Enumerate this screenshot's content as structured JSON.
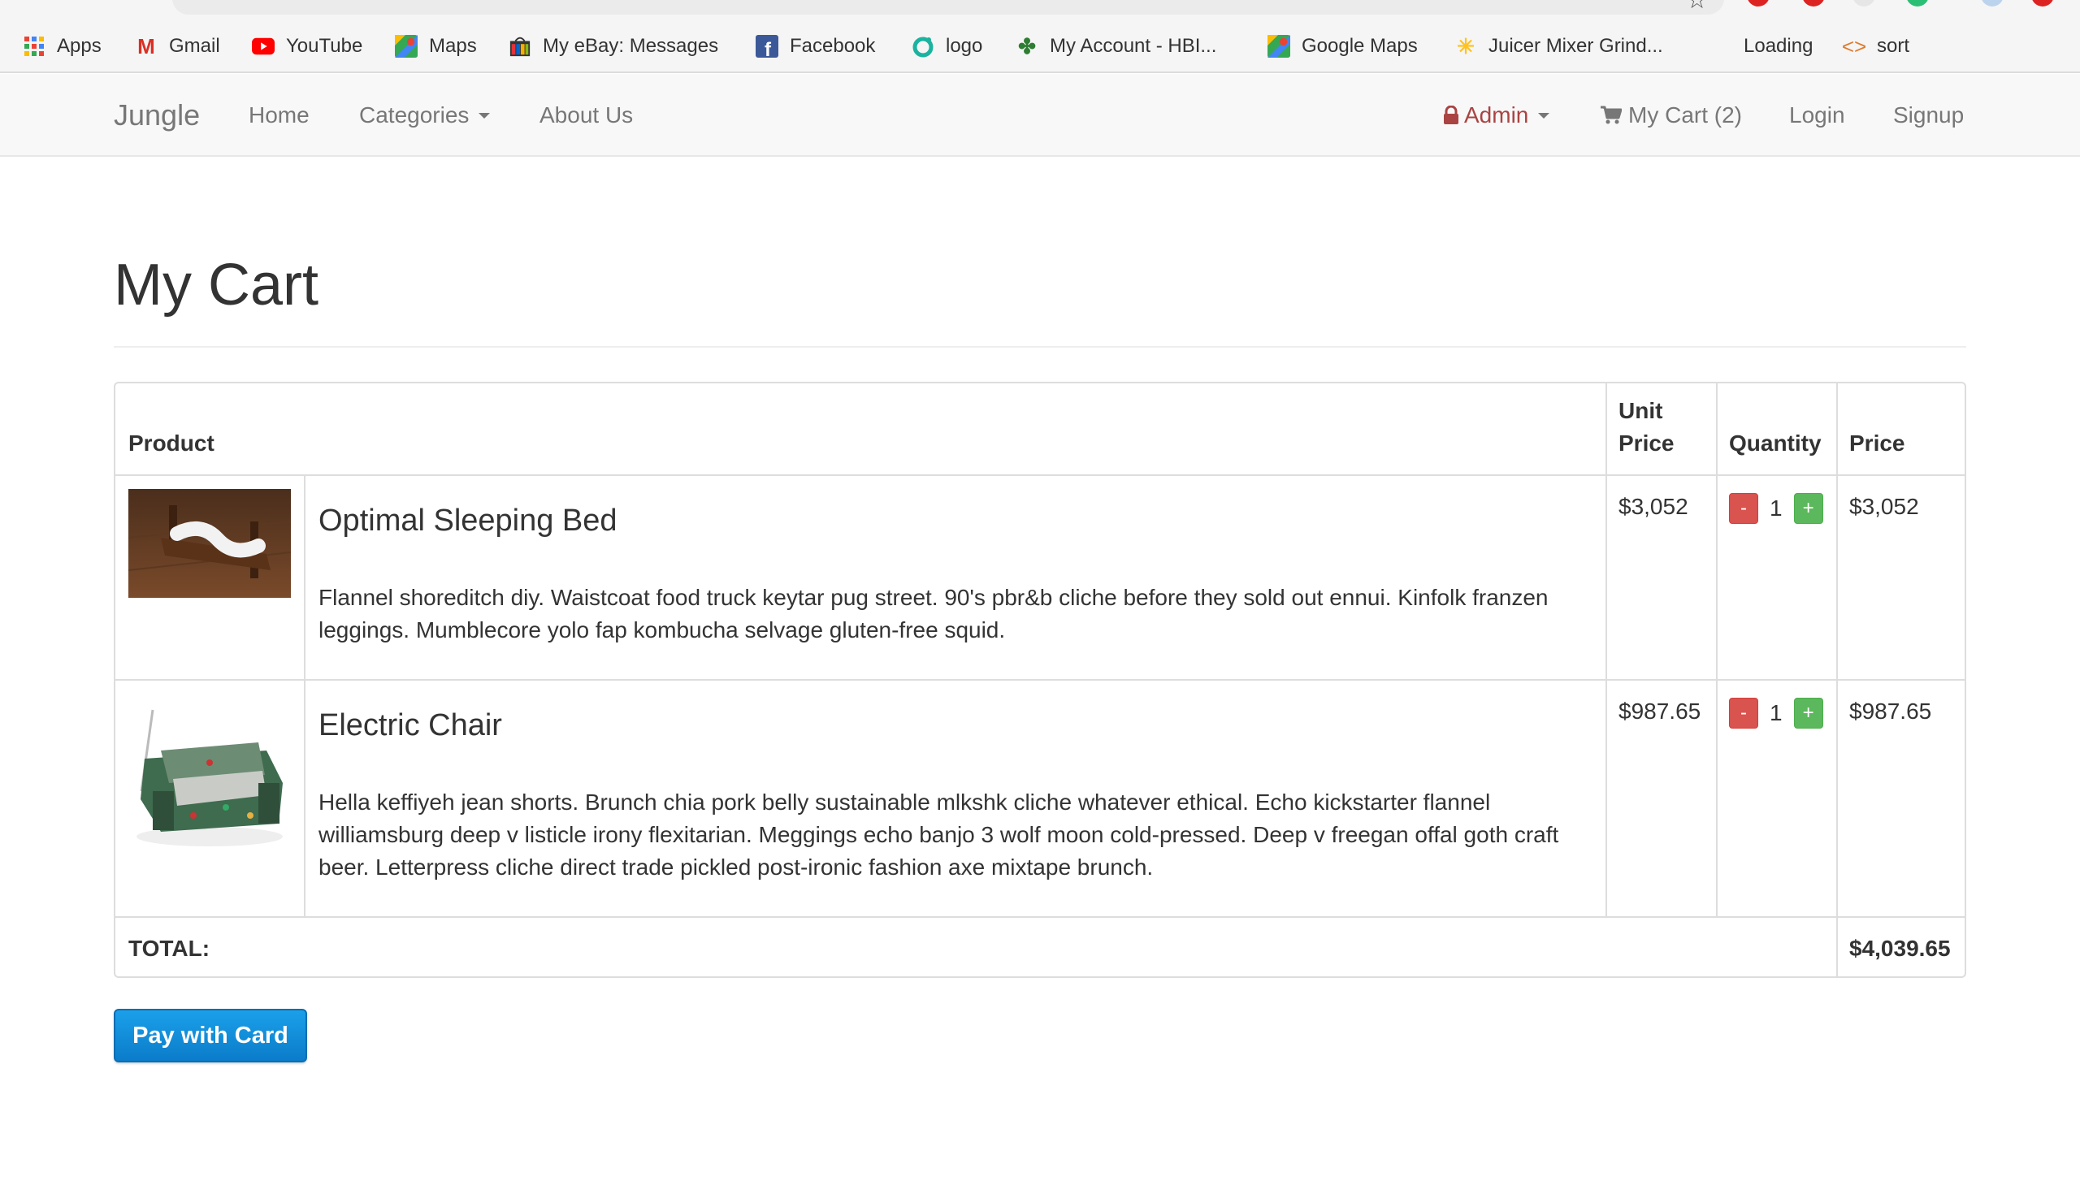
{
  "bookmarks": [
    {
      "label": "Apps",
      "icon": "apps-grid-icon"
    },
    {
      "label": "Gmail",
      "icon": "gmail-icon"
    },
    {
      "label": "YouTube",
      "icon": "youtube-icon"
    },
    {
      "label": "Maps",
      "icon": "maps-icon"
    },
    {
      "label": "My eBay: Messages",
      "icon": "ebay-icon"
    },
    {
      "label": "Facebook",
      "icon": "facebook-icon"
    },
    {
      "label": "logo",
      "icon": "logo-ring-icon"
    },
    {
      "label": "My Account - HBI...",
      "icon": "maple-leaf-icon"
    },
    {
      "label": "Google Maps",
      "icon": "maps-icon"
    },
    {
      "label": "Juicer Mixer Grind...",
      "icon": "walmart-spark-icon"
    },
    {
      "label": "Loading",
      "icon": ""
    },
    {
      "label": "sort",
      "icon": "code-brackets-icon"
    }
  ],
  "navbar": {
    "brand": "Jungle",
    "home": "Home",
    "categories": "Categories",
    "about": "About Us",
    "admin": "Admin",
    "cart": "My Cart (2)",
    "login": "Login",
    "signup": "Signup"
  },
  "page": {
    "title": "My Cart"
  },
  "table": {
    "headers": {
      "product": "Product",
      "unit_price_1": "Unit",
      "unit_price_2": "Price",
      "quantity": "Quantity",
      "price": "Price"
    },
    "rows": [
      {
        "name": "Optimal Sleeping Bed",
        "description": "Flannel shoreditch diy. Waistcoat food truck keytar pug street. 90's pbr&b cliche before they sold out ennui. Kinfolk franzen leggings. Mumblecore yolo fap kombucha selvage gluten-free squid.",
        "unit_price": "$3,052",
        "quantity": "1",
        "price": "$3,052",
        "minus": "-",
        "plus": "+"
      },
      {
        "name": "Electric Chair",
        "description": "Hella keffiyeh jean shorts. Brunch chia pork belly sustainable mlkshk cliche whatever ethical. Echo kickstarter flannel williamsburg deep v listicle irony flexitarian. Meggings echo banjo 3 wolf moon cold-pressed. Deep v freegan offal goth craft beer. Letterpress cliche direct trade pickled post-ironic fashion axe mixtape brunch.",
        "unit_price": "$987.65",
        "quantity": "1",
        "price": "$987.65",
        "minus": "-",
        "plus": "+"
      }
    ],
    "total_label": "TOTAL:",
    "total_value": "$4,039.65"
  },
  "pay_button": "Pay with Card",
  "colors": {
    "brand_admin": "#a94442",
    "pay_button": "#1a8fdc",
    "minus_button": "#d9534f",
    "plus_button": "#5cb85c"
  }
}
